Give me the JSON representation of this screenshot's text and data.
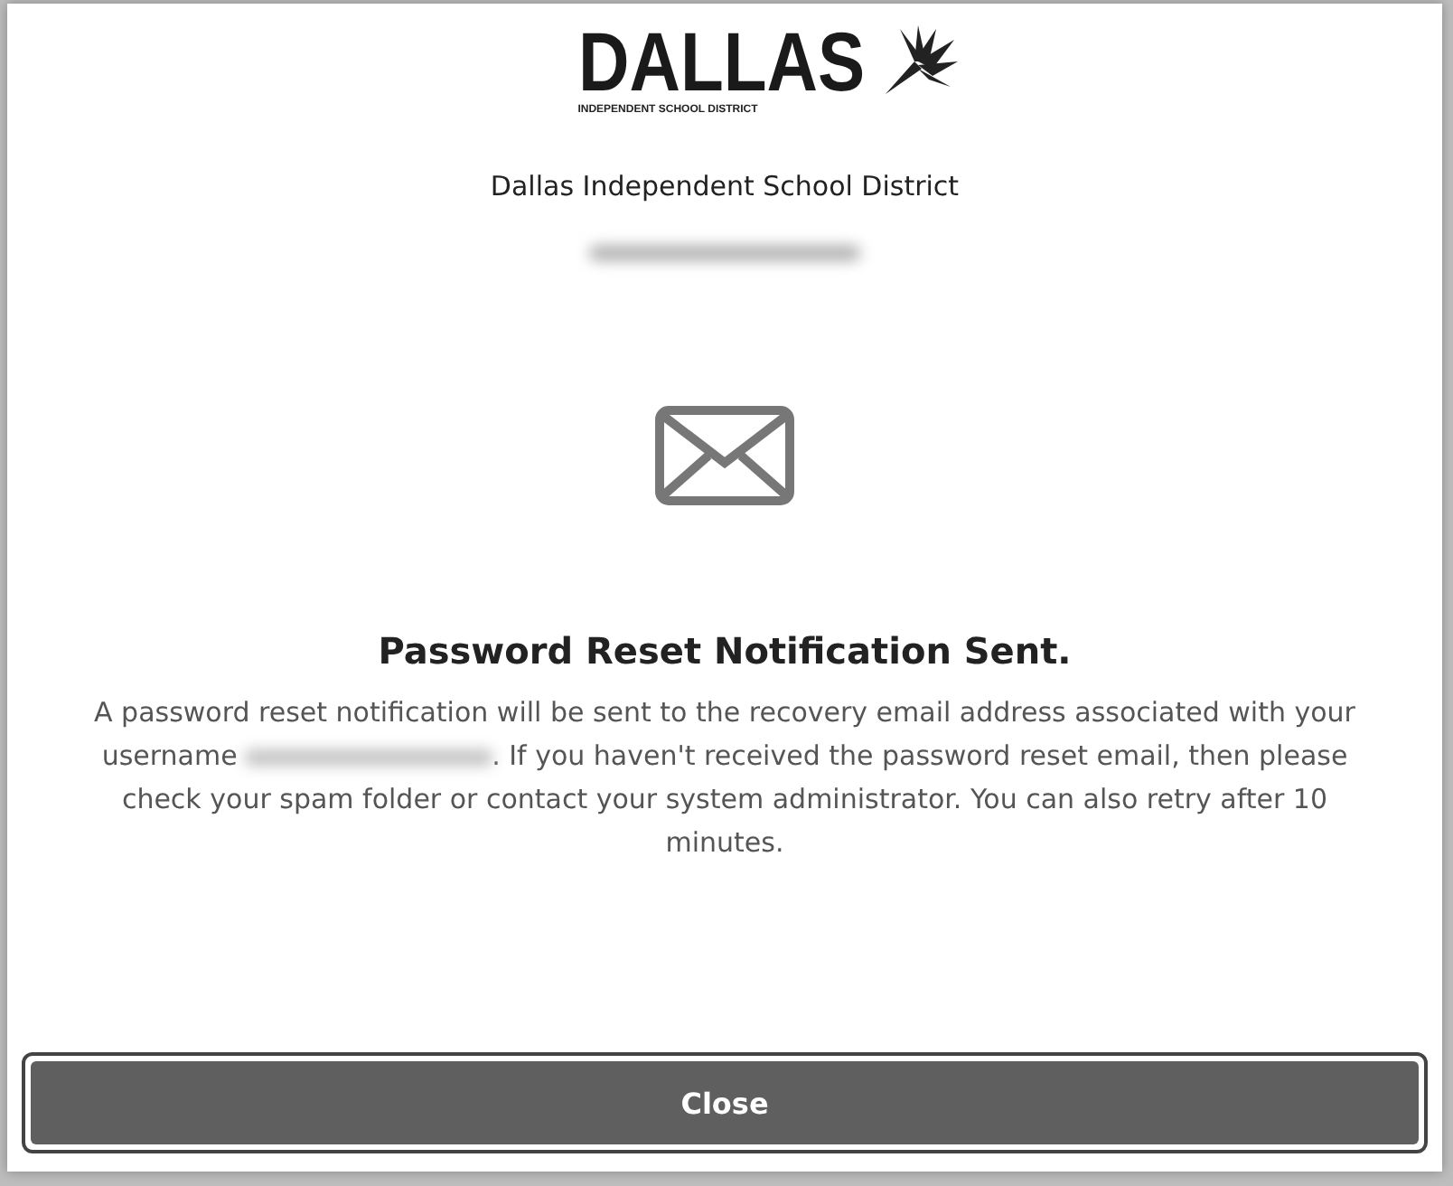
{
  "logo": {
    "wordmark": "DALLAS",
    "subtitle": "INDEPENDENT SCHOOL DISTRICT"
  },
  "organization": "Dallas Independent School District",
  "heading": "Password Reset Notification Sent.",
  "message": {
    "before": "A password reset notification will be sent to the recovery email address associated with your username",
    "after": ". If you haven't received the password reset email, then please check your spam folder or contact your system administrator. You can also retry after 10 minutes."
  },
  "buttons": [
    {
      "label": "Close"
    }
  ]
}
